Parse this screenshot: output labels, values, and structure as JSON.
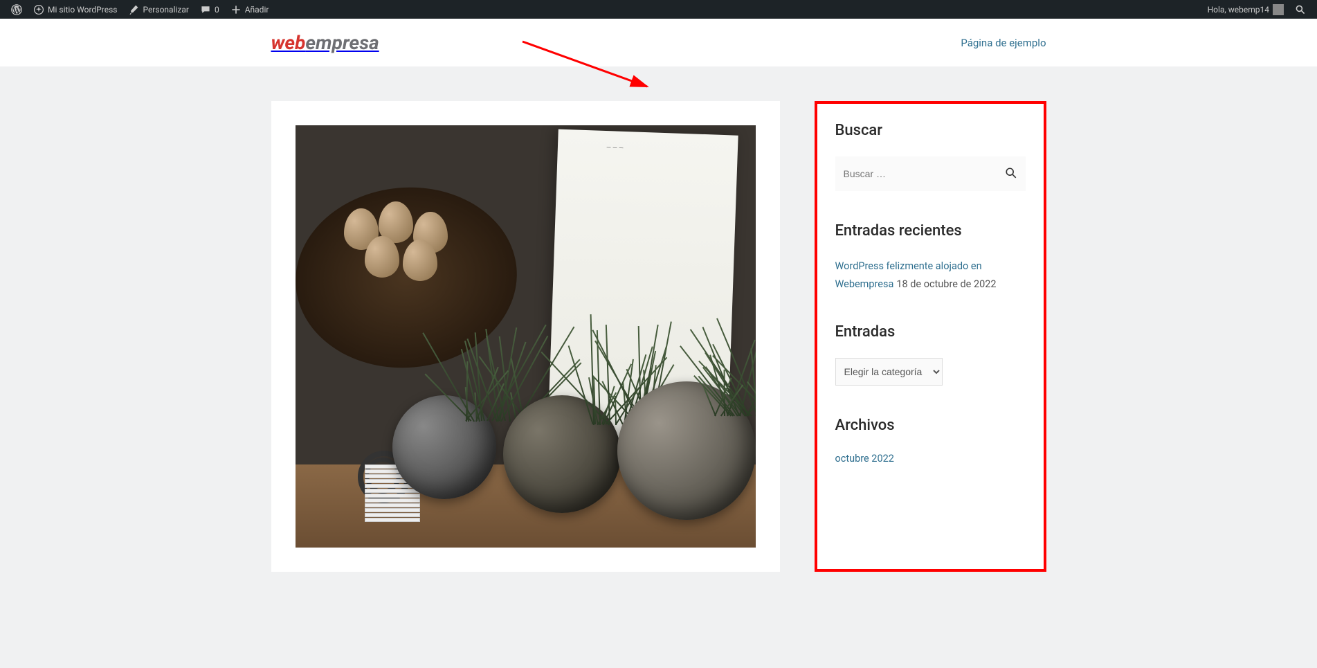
{
  "admin_bar": {
    "site_name": "Mi sitio WordPress",
    "customize": "Personalizar",
    "comments_count": "0",
    "add_new": "Añadir",
    "greeting": "Hola, webemp14"
  },
  "header": {
    "logo_part1": "web",
    "logo_part2": "empresa",
    "nav_link": "Página de ejemplo"
  },
  "sidebar": {
    "search": {
      "title": "Buscar",
      "placeholder": "Buscar …"
    },
    "recent": {
      "title": "Entradas recientes",
      "entry_title": "WordPress felizmente alojado en Webempresa",
      "entry_date": "18 de octubre de 2022"
    },
    "categories": {
      "title": "Entradas",
      "select_label": "Elegir la categoría"
    },
    "archives": {
      "title": "Archivos",
      "link": "octubre 2022"
    }
  }
}
